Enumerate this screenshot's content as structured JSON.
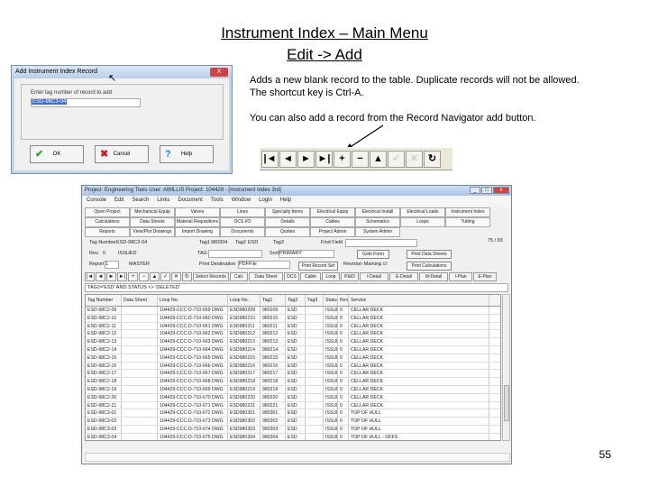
{
  "slide": {
    "title_line1": "Instrument Index – Main Menu",
    "title_line2": "Edit -> Add",
    "desc1": "Adds a new blank record to the table.  Duplicate records will not be allowed. The shortcut key is Ctrl-A.",
    "desc2": "You can also add a record from the Record Navigator add button.",
    "page_number": "55"
  },
  "dialog": {
    "title": "Add Instrument Index Record",
    "close": "X",
    "prompt": "Enter tag number of record to add",
    "value": "ESD-98C3-04",
    "ok": "OK",
    "cancel": "Cancel",
    "help": "Help"
  },
  "navigator": [
    "|◄",
    "◄",
    "►",
    "►|",
    "+",
    "−",
    "▲",
    "✓",
    "✕",
    "↻"
  ],
  "window": {
    "title": "Project: Engineering Tools      User: AWILLIS    Project: 104429 - [Instrument Index 3rd]",
    "menu": [
      "Console",
      "Edit",
      "Search",
      "Links",
      "Document",
      "Tools",
      "Window",
      "Login",
      "Help"
    ],
    "nav_buttons": [
      "Open Project",
      "Mechanical Equip",
      "Valves",
      "Lines",
      "Specialty Items",
      "Electrical Equip",
      "Electrical Install",
      "Electrical Loads",
      "Instrument Index",
      "Calculations",
      "Data Sheets",
      "Material Requisitions",
      "DCS I/O",
      "Details",
      "Cables",
      "Schematics",
      "Loops",
      "Tubing",
      "Reports",
      "View/Plot Drawings",
      "Import Drawing",
      "Documents",
      "Quotes",
      "Project Admin",
      "System Admin",
      "",
      ""
    ],
    "fields": {
      "tag_number_label": "Tag Number",
      "tag_number": "ESD-98C3-04",
      "tag1_label": "Tag1",
      "tag1": "980304",
      "tag2_label": "Tag2",
      "tag2": "ESD",
      "tag3_label": "Tag3",
      "find_field_label": "Find Field",
      "record_count": "75 / 83",
      "rev_label": "Rev.",
      "rev": "0",
      "status": "ISSUED",
      "tag_label": "TAG",
      "sort_label": "Sort",
      "sort": "PRIMARY",
      "goto_form": "Goto Form",
      "print_data_sheets": "Print Data Sheets",
      "report_no_label": "Report No.",
      "report_no": "1",
      "master": "MASTER",
      "print_destination_label": "Print Destination",
      "print_destination": "PDFFile",
      "print_record_set": "Print Record Set",
      "revision_marking_label": "Revision Marking ☑",
      "print_calculations": "Print Calculations"
    },
    "record_buttons": [
      "Select Records",
      "Calc",
      "Data Sheet",
      "DCS",
      "Cable",
      "Loop",
      "P&ID",
      "I-Detail",
      "E-Detail",
      "M-Detail",
      "I-Plan",
      "E-Plan"
    ],
    "filter": "TAG2='ESD' AND STATUS <> 'DELETED'",
    "columns": [
      "Tag Number",
      "Data Sheet",
      "Loop No.",
      "Loop No.",
      "Tag1",
      "Tag2",
      "Tag3",
      "Status",
      "Rev",
      "Service"
    ],
    "rows": [
      [
        "ESD-98C2-09",
        "",
        "104429-CCC-D-710-659 DWG",
        "ESD980209",
        "980209",
        "ESD",
        "",
        "ISSUED",
        "0",
        "CELLAR DECK"
      ],
      [
        "ESD-98C2-10",
        "",
        "104429-CCC-D-710-660 DWG",
        "ESD980210",
        "980210",
        "ESD",
        "",
        "ISSUED",
        "0",
        "CELLAR DECK"
      ],
      [
        "ESD-98C2-11",
        "",
        "104429-CCC-D-710-661 DWG",
        "ESD980211",
        "980211",
        "ESD",
        "",
        "ISSUED",
        "0",
        "CELLAR DECK"
      ],
      [
        "ESD-98C2-12",
        "",
        "104429-CCC-D-710-662 DWG",
        "ESD980212",
        "980212",
        "ESD",
        "",
        "ISSUED",
        "0",
        "CELLAR DECK"
      ],
      [
        "ESD-98C2-13",
        "",
        "104429-CCC-D-710-663 DWG",
        "ESD980213",
        "980213",
        "ESD",
        "",
        "ISSUED",
        "0",
        "CELLAR DECK"
      ],
      [
        "ESD-98C2-14",
        "",
        "104429-CCC-D-710-664 DWG",
        "ESD980214",
        "980214",
        "ESD",
        "",
        "ISSUED",
        "0",
        "CELLAR DECK"
      ],
      [
        "ESD-98C2-15",
        "",
        "104429-CCC-D-710-665 DWG",
        "ESD980215",
        "980215",
        "ESD",
        "",
        "ISSUED",
        "0",
        "CELLAR DECK"
      ],
      [
        "ESD-98C2-16",
        "",
        "104429-CCC-D-710-666 DWG",
        "ESD980216",
        "980216",
        "ESD",
        "",
        "ISSUED",
        "0",
        "CELLAR DECK"
      ],
      [
        "ESD-98C2-17",
        "",
        "104429-CCC-D-710-667 DWG",
        "ESD980217",
        "980217",
        "ESD",
        "",
        "ISSUED",
        "0",
        "CELLAR DECK"
      ],
      [
        "ESD-98C2-18",
        "",
        "104429-CCC-D-710-668 DWG",
        "ESD980218",
        "980218",
        "ESD",
        "",
        "ISSUED",
        "0",
        "CELLAR DECK"
      ],
      [
        "ESD-98C2-19",
        "",
        "104429-CCC-D-710-669 DWG",
        "ESD980219",
        "980219",
        "ESD",
        "",
        "ISSUED",
        "0",
        "CELLAR DECK"
      ],
      [
        "ESD-98C2-20",
        "",
        "104429-CCC-D-710-670 DWG",
        "ESD980220",
        "980220",
        "ESD",
        "",
        "ISSUED",
        "0",
        "CELLAR DECK"
      ],
      [
        "ESD-98C2-21",
        "",
        "104429-CCC-D-710-671 DWG",
        "ESD980221",
        "980221",
        "ESD",
        "",
        "ISSUED",
        "0",
        "CELLAR DECK"
      ],
      [
        "ESD-98C3-01",
        "",
        "104429-CCC-D-710-672 DWG",
        "ESD980301",
        "980301",
        "ESD",
        "",
        "ISSUED",
        "0",
        "TOP OF HULL"
      ],
      [
        "ESD-98C3-02",
        "",
        "104429-CCC-D-710-673 DWG",
        "ESD980302",
        "980302",
        "ESD",
        "",
        "ISSUED",
        "0",
        "TOP OF HULL"
      ],
      [
        "ESD-98C3-03",
        "",
        "104429-CCC-D-710-674 DWG",
        "ESD980303",
        "980303",
        "ESD",
        "",
        "ISSUED",
        "0",
        "TOP OF HULL"
      ],
      [
        "ESD-98C3-04",
        "",
        "104429-CCC-D-710-675 DWG",
        "ESD980304",
        "980304",
        "ESD",
        "",
        "ISSUED",
        "0",
        "TOP OF HULL - OFFS"
      ]
    ]
  }
}
